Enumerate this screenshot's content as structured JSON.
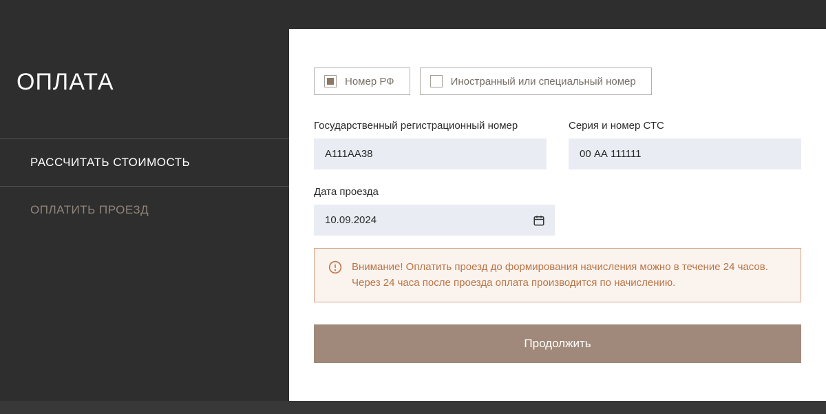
{
  "sidebar": {
    "title": "ОПЛАТА",
    "items": [
      {
        "label": "РАССЧИТАТЬ СТОИМОСТЬ"
      },
      {
        "label": "ОПЛАТИТЬ ПРОЕЗД"
      }
    ]
  },
  "radios": {
    "rf": "Номер РФ",
    "foreign": "Иностранный или специальный номер"
  },
  "fields": {
    "reg_number": {
      "label": "Государственный регистрационный номер",
      "value": "А111АА38"
    },
    "sts": {
      "label": "Серия и номер СТС",
      "value": "00 АА 111111"
    },
    "date": {
      "label": "Дата проезда",
      "value": "10.09.2024"
    }
  },
  "alert": {
    "text": "Внимание! Оплатить проезд до формирования начисления можно в течение 24 часов. Через 24 часа после проезда оплата производится по начислению."
  },
  "submit": {
    "label": "Продолжить"
  }
}
